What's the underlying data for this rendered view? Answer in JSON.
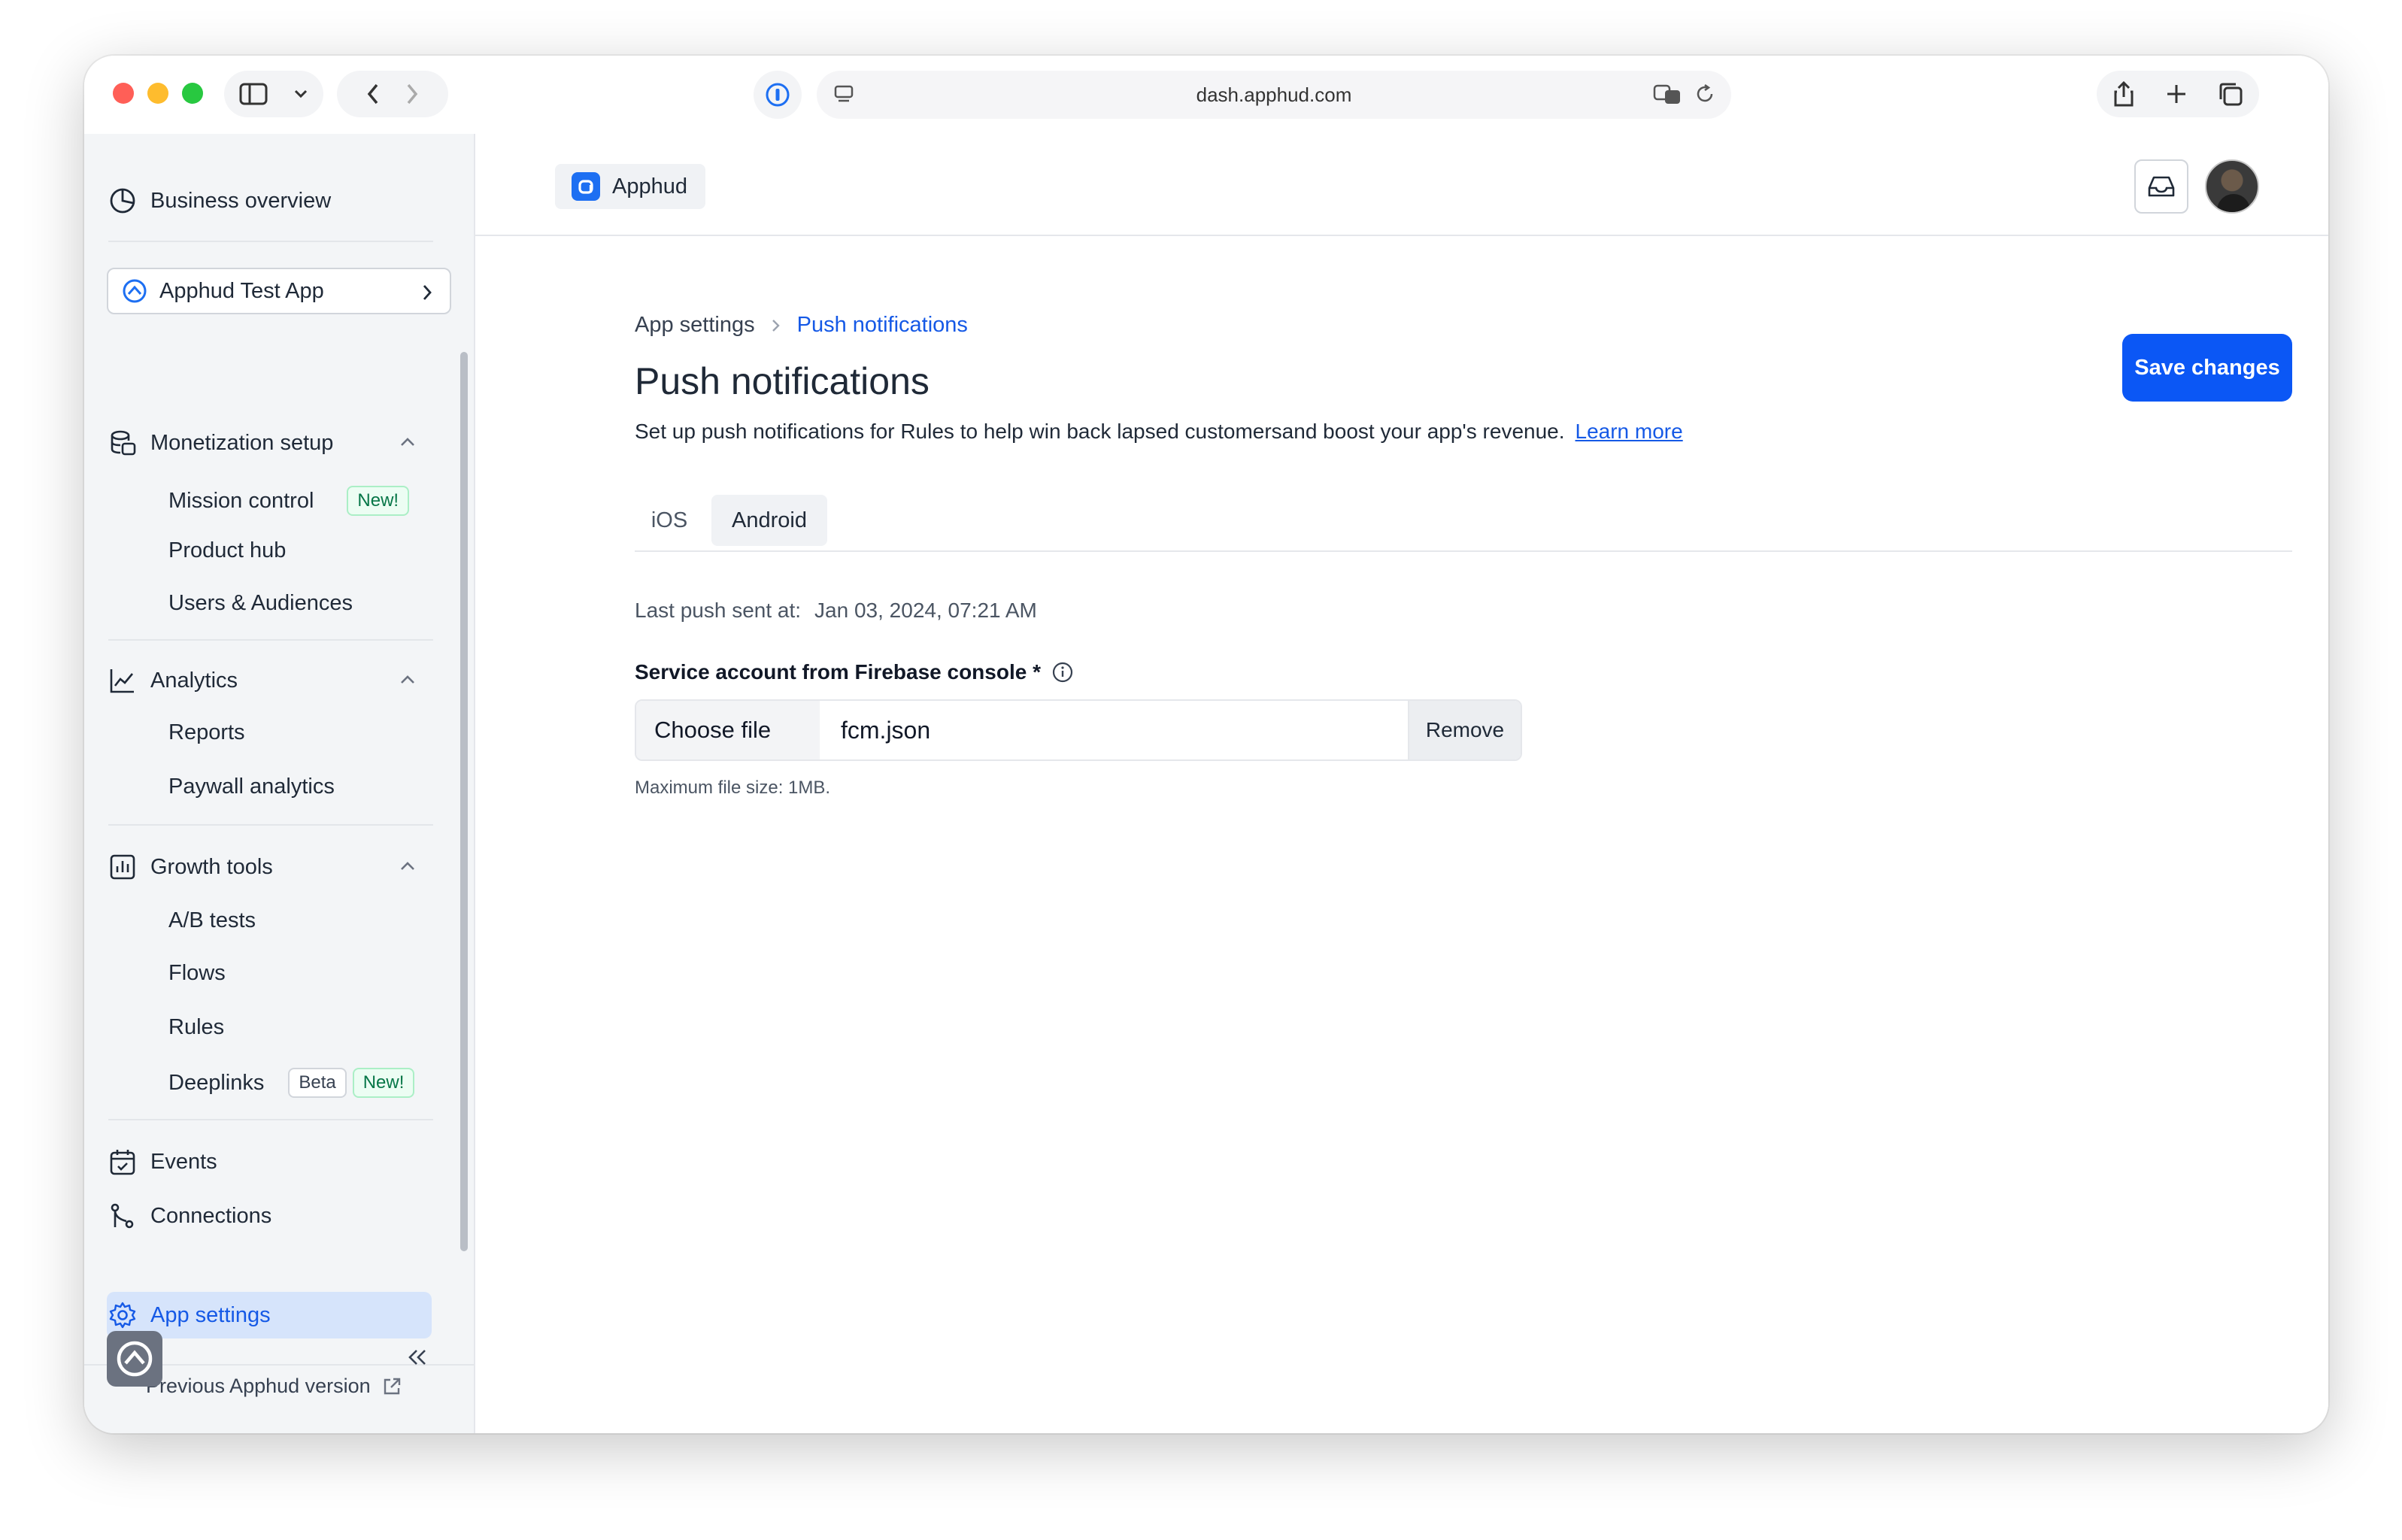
{
  "browser": {
    "url": "dash.apphud.com"
  },
  "sidebar": {
    "business_overview": "Business overview",
    "app_selector": "Apphud Test App",
    "sections": {
      "monetization": {
        "label": "Monetization setup",
        "items": [
          "Mission control",
          "Product hub",
          "Users & Audiences"
        ],
        "mission_badge": "New!"
      },
      "analytics": {
        "label": "Analytics",
        "items": [
          "Reports",
          "Paywall analytics"
        ]
      },
      "growth": {
        "label": "Growth tools",
        "items": [
          "A/B tests",
          "Flows",
          "Rules",
          "Deeplinks"
        ],
        "deeplinks_badges": [
          "Beta",
          "New!"
        ]
      }
    },
    "events": "Events",
    "connections": "Connections",
    "app_settings": "App settings",
    "previous_version": "Previous Apphud version"
  },
  "topbar": {
    "app_name": "Apphud"
  },
  "breadcrumb": {
    "parent": "App settings",
    "current": "Push notifications"
  },
  "page": {
    "title": "Push notifications",
    "subtitle": "Set up push notifications for Rules to help win back lapsed customersand boost your app's revenue.",
    "learn_more": "Learn more",
    "save_label": "Save changes"
  },
  "tabs": [
    "iOS",
    "Android"
  ],
  "active_tab": "Android",
  "form": {
    "last_push_label": "Last push sent at:",
    "last_push_value": "Jan 03, 2024, 07:21 AM",
    "field_label": "Service account from Firebase console *",
    "choose_label": "Choose file",
    "file_name": "fcm.json",
    "remove_label": "Remove",
    "hint": "Maximum file size: 1MB."
  },
  "colors": {
    "accent": "#0b57f5",
    "active_nav_bg": "#d6e4fb",
    "sidebar_bg": "#f3f5f7"
  }
}
